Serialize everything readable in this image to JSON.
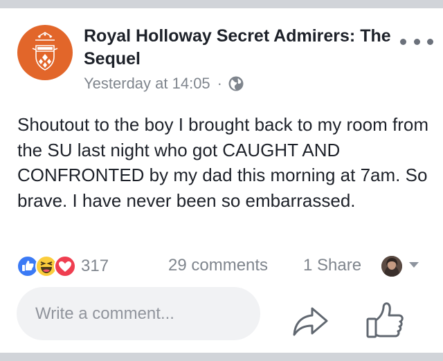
{
  "post": {
    "page_name": "Royal Holloway Secret Admirers: The Sequel",
    "timestamp": "Yesterday at 14:05",
    "separator": "·",
    "privacy_icon": "globe-icon",
    "body": "Shoutout to the boy I brought back to my room from the SU last night who got CAUGHT AND CONFRONTED by my dad this morning at 7am. So brave. I have never been so embarrassed."
  },
  "stats": {
    "reaction_icons": [
      "like-reaction-icon",
      "haha-reaction-icon",
      "love-reaction-icon"
    ],
    "reactions": "317",
    "comments": "29 comments",
    "shares": "1 Share"
  },
  "composer": {
    "placeholder": "Write a comment..."
  },
  "actions": {
    "share_icon": "share-arrow-icon",
    "like_icon": "thumbs-up-icon"
  },
  "colors": {
    "avatar_bg": "#e2662a",
    "text": "#1d2129",
    "meta": "#7f858d",
    "like_blue": "#3b7af5",
    "love_red": "#ef3e50",
    "haha_yellow": "#fbcd3c",
    "page_bg": "#d1d4d9"
  }
}
